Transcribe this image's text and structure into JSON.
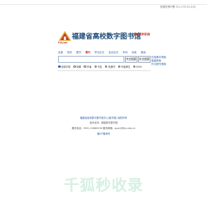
{
  "header": {
    "top_info": "您现在的IP是 211.170.22.2(2)"
  },
  "brand": {
    "logo_text": "FULink",
    "title": "福建省高校数字图书馆",
    "subtitle": "文献提供系统"
  },
  "nav": {
    "items": [
      "全部",
      "知识",
      "图书",
      "期刊",
      "学位论文",
      "会议论文",
      "专利",
      "标准",
      "报纸"
    ],
    "active_index": 3
  },
  "search": {
    "value": "",
    "button_search": "中文搜索",
    "button_foreign": "外文搜索"
  },
  "side_links": [
    "在结果中搜索",
    "高级搜索",
    "外文报刊搜索"
  ],
  "scope": {
    "options": [
      "全部字段",
      "标题",
      "作者",
      "刊名",
      "关键词",
      "作者单位",
      "ISSN"
    ],
    "selected_index": 0
  },
  "footer": {
    "line1": "福建省高校数字图书馆中心(医学馆) 版权所有",
    "line2": "技术支持：超星数字图书馆",
    "line3": "服务电话：0591-22868156  服务邮箱：guan@fjtu.edu.cn",
    "line4": "福ICP备案号"
  },
  "watermark": "千狐秒收录",
  "colors": {
    "brand_blue": "#1f4e7a",
    "link_blue": "#2b5aa8",
    "accent_red": "#c0392b",
    "watermark_green": "#d6f0e2"
  }
}
